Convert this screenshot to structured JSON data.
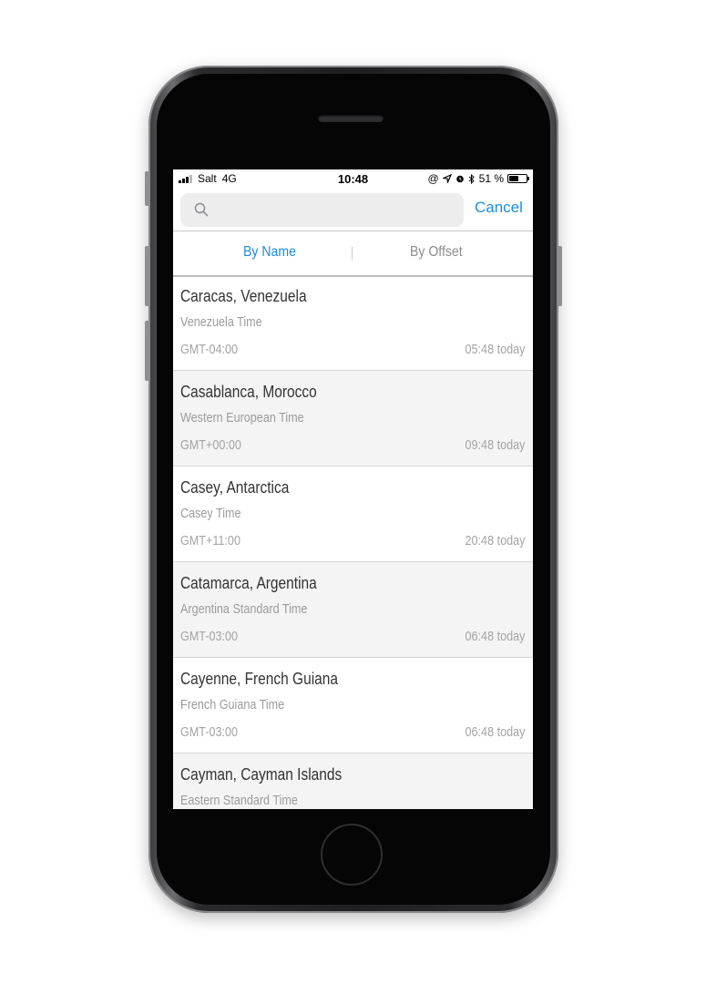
{
  "status_bar": {
    "carrier": "Salt",
    "network": "4G",
    "time": "10:48",
    "battery_percent": "51 %",
    "battery_level": 0.51,
    "icons": [
      "signal-icon",
      "at-sign-icon",
      "location-arrow-icon",
      "alarm-icon",
      "bluetooth-icon",
      "battery-icon"
    ]
  },
  "search": {
    "value": "",
    "placeholder": "",
    "cancel_label": "Cancel"
  },
  "tabs": [
    {
      "label": "By Name",
      "selected": true
    },
    {
      "label": "By Offset",
      "selected": false
    }
  ],
  "colors": {
    "accent": "#1c8ddb",
    "alt_row": "#f4f4f4"
  },
  "timezones": [
    {
      "city": "Caracas, Venezuela",
      "zone": "Venezuela Time",
      "offset": "GMT-04:00",
      "local": "05:48 today"
    },
    {
      "city": "Casablanca, Morocco",
      "zone": "Western European Time",
      "offset": "GMT+00:00",
      "local": "09:48 today"
    },
    {
      "city": "Casey, Antarctica",
      "zone": "Casey Time",
      "offset": "GMT+11:00",
      "local": "20:48 today"
    },
    {
      "city": "Catamarca, Argentina",
      "zone": "Argentina Standard Time",
      "offset": "GMT-03:00",
      "local": "06:48 today"
    },
    {
      "city": "Cayenne, French Guiana",
      "zone": "French Guiana Time",
      "offset": "GMT-03:00",
      "local": "06:48 today"
    },
    {
      "city": "Cayman, Cayman Islands",
      "zone": "Eastern Standard Time",
      "offset": "",
      "local": ""
    }
  ]
}
